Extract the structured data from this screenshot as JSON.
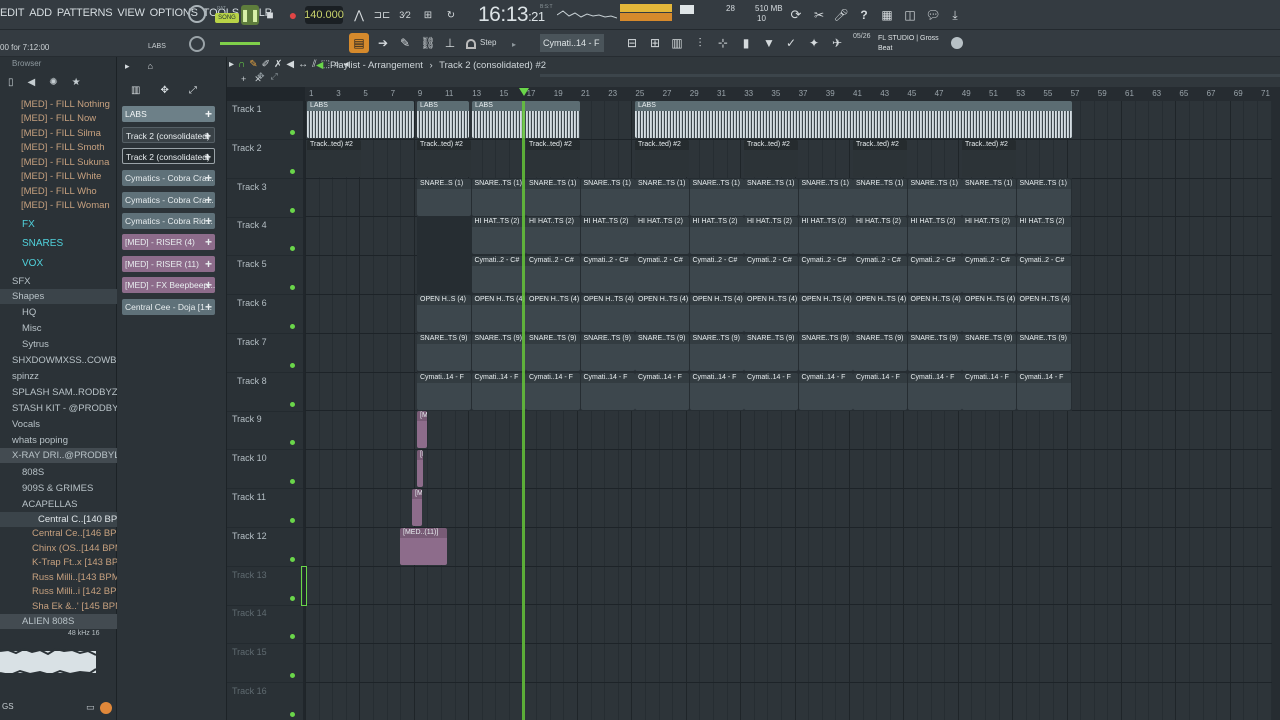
{
  "menu": [
    "EDIT",
    "ADD",
    "PATTERNS",
    "VIEW",
    "OPTIONS",
    "TOOLS",
    "HELP"
  ],
  "transport": {
    "pat": "PAT",
    "song": "SONG",
    "bpm": "140.000",
    "time": "16:13",
    "time_sub": ":21",
    "beat_label": "B:S:T",
    "meter_top": "28",
    "meter_bottom": "10",
    "memory": "510 MB",
    "cpu_label": "0"
  },
  "hint": "00 for 7:12:00",
  "channel_label": "LABS",
  "snap": "Step",
  "pattern_selector": "Cymati..14 - F",
  "news": {
    "date": "05/26",
    "text": "FL STUDIO | Gross Beat"
  },
  "browser": {
    "title": "Browser",
    "items": [
      {
        "label": "[MED] - FILL Nothing"
      },
      {
        "label": "[MED] - FILL Now"
      },
      {
        "label": "[MED] - FILL Silma"
      },
      {
        "label": "[MED] - FILL Smoth"
      },
      {
        "label": "[MED] - FILL Sukuna"
      },
      {
        "label": "[MED] - FILL White"
      },
      {
        "label": "[MED] - FILL Who"
      },
      {
        "label": "[MED] - FILL Woman"
      },
      {
        "label": "FX"
      },
      {
        "label": "SNARES"
      },
      {
        "label": "VOX"
      },
      {
        "label": "SFX"
      },
      {
        "label": "Shapes"
      },
      {
        "label": "HQ"
      },
      {
        "label": "Misc"
      },
      {
        "label": "Sytrus"
      },
      {
        "label": "SHXDOWMXSS..COWBELLS"
      },
      {
        "label": "spinzz"
      },
      {
        "label": "SPLASH SAM..RODBYZAWN"
      },
      {
        "label": "STASH KIT - @PRODBYLJS"
      },
      {
        "label": "Vocals"
      },
      {
        "label": "whats poping"
      },
      {
        "label": "X-RAY DRI..@PRODBYLJS"
      },
      {
        "label": "808S"
      },
      {
        "label": "909S & GRIMES"
      },
      {
        "label": "ACAPELLAS"
      },
      {
        "label": "Central C..[140 BPM]"
      },
      {
        "label": "Central Ce..[146 BPM]"
      },
      {
        "label": "Chinx (OS..[144 BPM]"
      },
      {
        "label": "K-Trap Ft..x [143 BPM]"
      },
      {
        "label": "Russ Milli..[143 BPM]"
      },
      {
        "label": "Russ Milli..i [142 BPM]"
      },
      {
        "label": "Sha Ek &..' [145 BPM]"
      },
      {
        "label": "ALIEN 808S"
      }
    ],
    "sample_rate": "48 kHz 16"
  },
  "picker": [
    {
      "label": "LABS",
      "color": "#6d8088"
    },
    {
      "label": "Track 2 (consolidated)",
      "color": "#3a4247"
    },
    {
      "label": "Track 2 (consolidated)",
      "color": "#2e3539"
    },
    {
      "label": "Cymatics - Cobra Cra...",
      "color": "#5f7179"
    },
    {
      "label": "Cymatics - Cobra Cra...",
      "color": "#5f7179"
    },
    {
      "label": "Cymatics - Cobra Rid...",
      "color": "#5f7179"
    },
    {
      "label": "[MED] - RISER (4)",
      "color": "#8d6c8b"
    },
    {
      "label": "[MED] - RISER (11)",
      "color": "#8d6c8b"
    },
    {
      "label": "[MED] - FX Beepbeep...",
      "color": "#8d6c8b"
    },
    {
      "label": "Central Cee - Doja [1...",
      "color": "#5f7179"
    }
  ],
  "playlist": {
    "title": "Playlist - Arrangement",
    "track": "Track 2 (consolidated) #2"
  },
  "ruler": [
    "1",
    "3",
    "5",
    "7",
    "9",
    "11",
    "13",
    "15",
    "17",
    "19",
    "21",
    "23",
    "25",
    "27",
    "29",
    "31",
    "33",
    "35",
    "37",
    "39",
    "41",
    "43",
    "45",
    "47",
    "49",
    "51",
    "53",
    "55",
    "57",
    "59",
    "61",
    "63",
    "65",
    "67",
    "69",
    "71"
  ],
  "tracks": [
    "Track 1",
    "Track 2",
    "Track 3",
    "Track 4",
    "Track 5",
    "Track 6",
    "Track 7",
    "Track 8",
    "Track 9",
    "Track 10",
    "Track 11",
    "Track 12",
    "Track 13",
    "Track 14",
    "Track 15",
    "Track 16"
  ],
  "clips": {
    "t1": "LABS",
    "t2": "Track..ted) #2",
    "t3": "SNARE..S (1)",
    "t3b": "SNARE..TS (1)",
    "t4": "HI HAT..TS (2)",
    "t5": "Cymati..2 - C#",
    "t6": "OPEN H..S (4)",
    "t6b": "OPEN H..TS (4)",
    "t7": "SNARE..TS (9)",
    "t8": "Cymati..14 - F",
    "t12": "[MED..(11)]"
  }
}
